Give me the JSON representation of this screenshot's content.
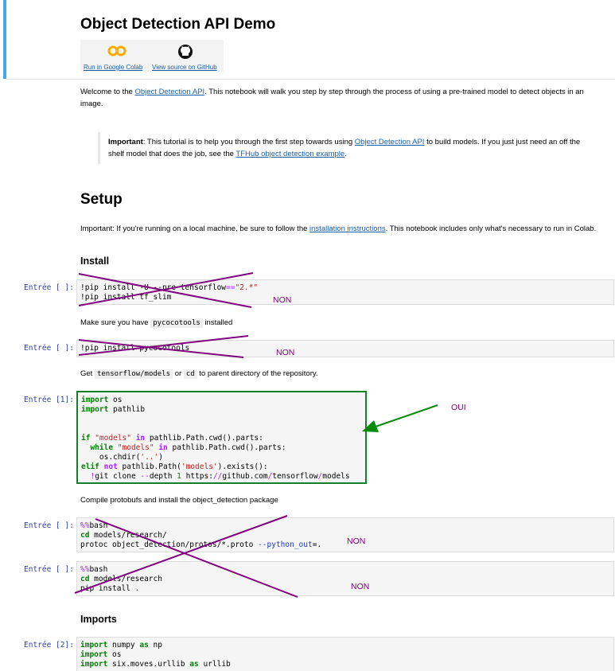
{
  "header": {
    "title": "Object Detection API Demo",
    "colab_label": "Run in Google Colab",
    "github_label": "View source on GitHub"
  },
  "intro": {
    "pre": "Welcome to the ",
    "link": "Object Detection API",
    "post": ". This notebook will walk you step by step through the process of using a pre-trained model to detect objects in an image."
  },
  "note": {
    "bold": "Important",
    "t1": ": This tutorial is to help you through the first step towards using ",
    "link1": "Object Detection API",
    "t2": " to build models. If you just just need an off the shelf model that does the job, see the ",
    "link2": "TFHub object detection example",
    "t3": "."
  },
  "setup": {
    "heading": "Setup",
    "pre": "Important: If you're running on a local machine, be sure to follow the ",
    "link": "installation instructions",
    "post": ". This notebook includes only what's necessary to run in Colab."
  },
  "install_heading": "Install",
  "imports_heading": "Imports",
  "texts": {
    "make_sure_pre": "Make sure you have ",
    "make_sure_code": "pycocotools",
    "make_sure_post": " installed",
    "get_pre": "Get ",
    "get_code1": "tensorflow/models",
    "get_mid": " or ",
    "get_code2": "cd",
    "get_post": " to parent directory of the repository.",
    "compile": "Compile protobufs and install the object_detection package"
  },
  "prompts": {
    "cell1": "Entrée [ ]:",
    "cell2": "Entrée [ ]:",
    "cell3": "Entrée [1]:",
    "cell4": "Entrée [ ]:",
    "cell5": "Entrée [ ]:",
    "cell6": "Entrée [2]:"
  },
  "marks": {
    "non1": "NON",
    "non2": "NON",
    "oui": "OUI",
    "non3": "NON",
    "non4": "NON"
  },
  "colors": {
    "accent_bar": "#42a5f5",
    "link": "#1a5fa8",
    "prompt": "#303f9f",
    "selected_border": "#137f2a",
    "annotation": "#800080"
  }
}
